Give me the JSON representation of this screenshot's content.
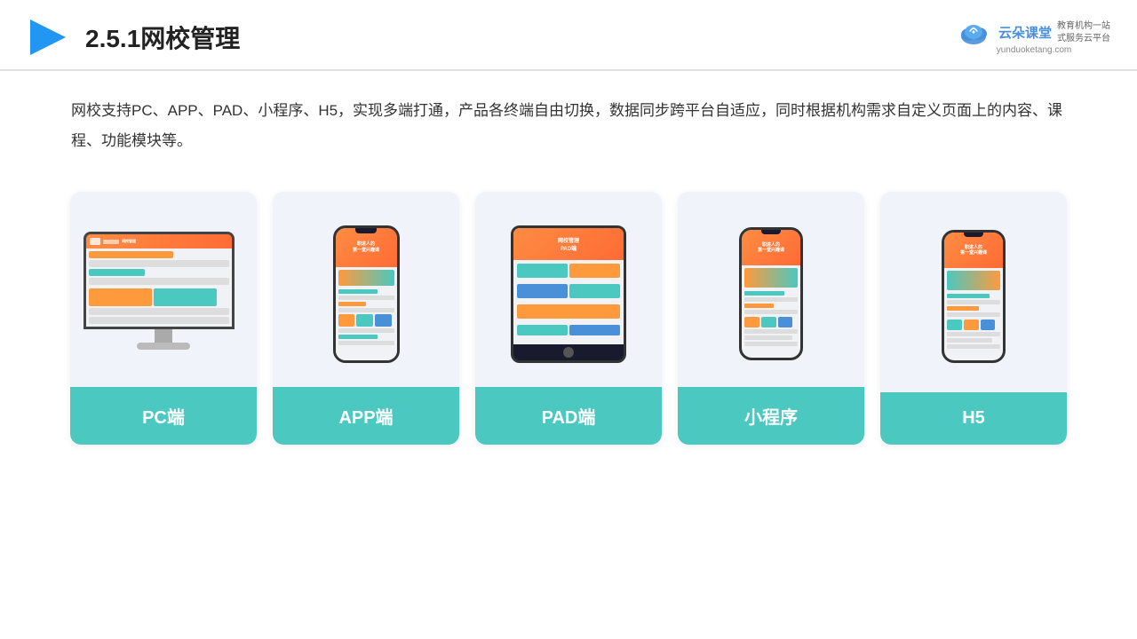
{
  "header": {
    "title": "2.5.1网校管理",
    "logo_brand": "云朵课堂",
    "logo_url": "yunduoketang.com",
    "logo_tagline_line1": "教育机构一站",
    "logo_tagline_line2": "式服务云平台"
  },
  "description": {
    "text": "网校支持PC、APP、PAD、小程序、H5，实现多端打通，产品各终端自由切换，数据同步跨平台自适应，同时根据机构需求自定义页面上的内容、课程、功能模块等。"
  },
  "cards": [
    {
      "id": "pc",
      "label": "PC端"
    },
    {
      "id": "app",
      "label": "APP端"
    },
    {
      "id": "pad",
      "label": "PAD端"
    },
    {
      "id": "miniprogram",
      "label": "小程序"
    },
    {
      "id": "h5",
      "label": "H5"
    }
  ],
  "brand_color": "#4bc8c0"
}
